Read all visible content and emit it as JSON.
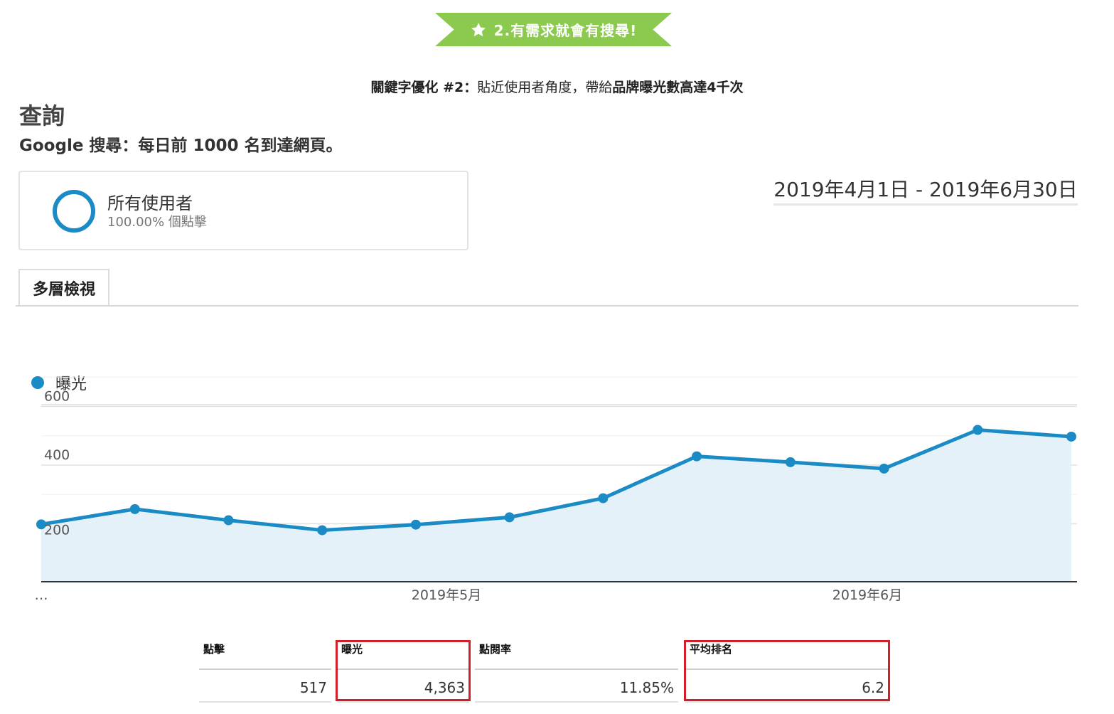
{
  "banner": {
    "text": "2.有需求就會有搜尋!",
    "icon": "star-icon",
    "color": "#8cc94f"
  },
  "subtitle": {
    "prefix": "關鍵字優化 #2：",
    "middle": "貼近使用者角度，帶給",
    "emphasis": "品牌曝光數高達4千次"
  },
  "page": {
    "title": "查詢",
    "description": "Google 搜尋：每日前 1000 名到達網頁。"
  },
  "segment": {
    "name": "所有使用者",
    "meta": "100.00% 個點擊"
  },
  "date_range": "2019年4月1日 - 2019年6月30日",
  "tab": {
    "label": "多層檢視"
  },
  "legend": {
    "label": "曝光",
    "color": "#1a8bc4"
  },
  "chart_data": {
    "type": "area",
    "series": [
      {
        "name": "曝光",
        "values": [
          198,
          250,
          212,
          178,
          197,
          222,
          287,
          430,
          410,
          388,
          520,
          497
        ]
      }
    ],
    "y_ticks": [
      200,
      400,
      600
    ],
    "x_tick_labels": [
      "…",
      "2019年5月",
      "2019年6月"
    ],
    "grid": true,
    "color": "#1a8bc4"
  },
  "metrics": [
    {
      "label": "點擊",
      "value": "517",
      "highlighted": false
    },
    {
      "label": "曝光",
      "value": "4,363",
      "highlighted": true
    },
    {
      "label": "點閱率",
      "value": "11.85%",
      "highlighted": false
    },
    {
      "label": "平均排名",
      "value": "6.2",
      "highlighted": true
    }
  ]
}
